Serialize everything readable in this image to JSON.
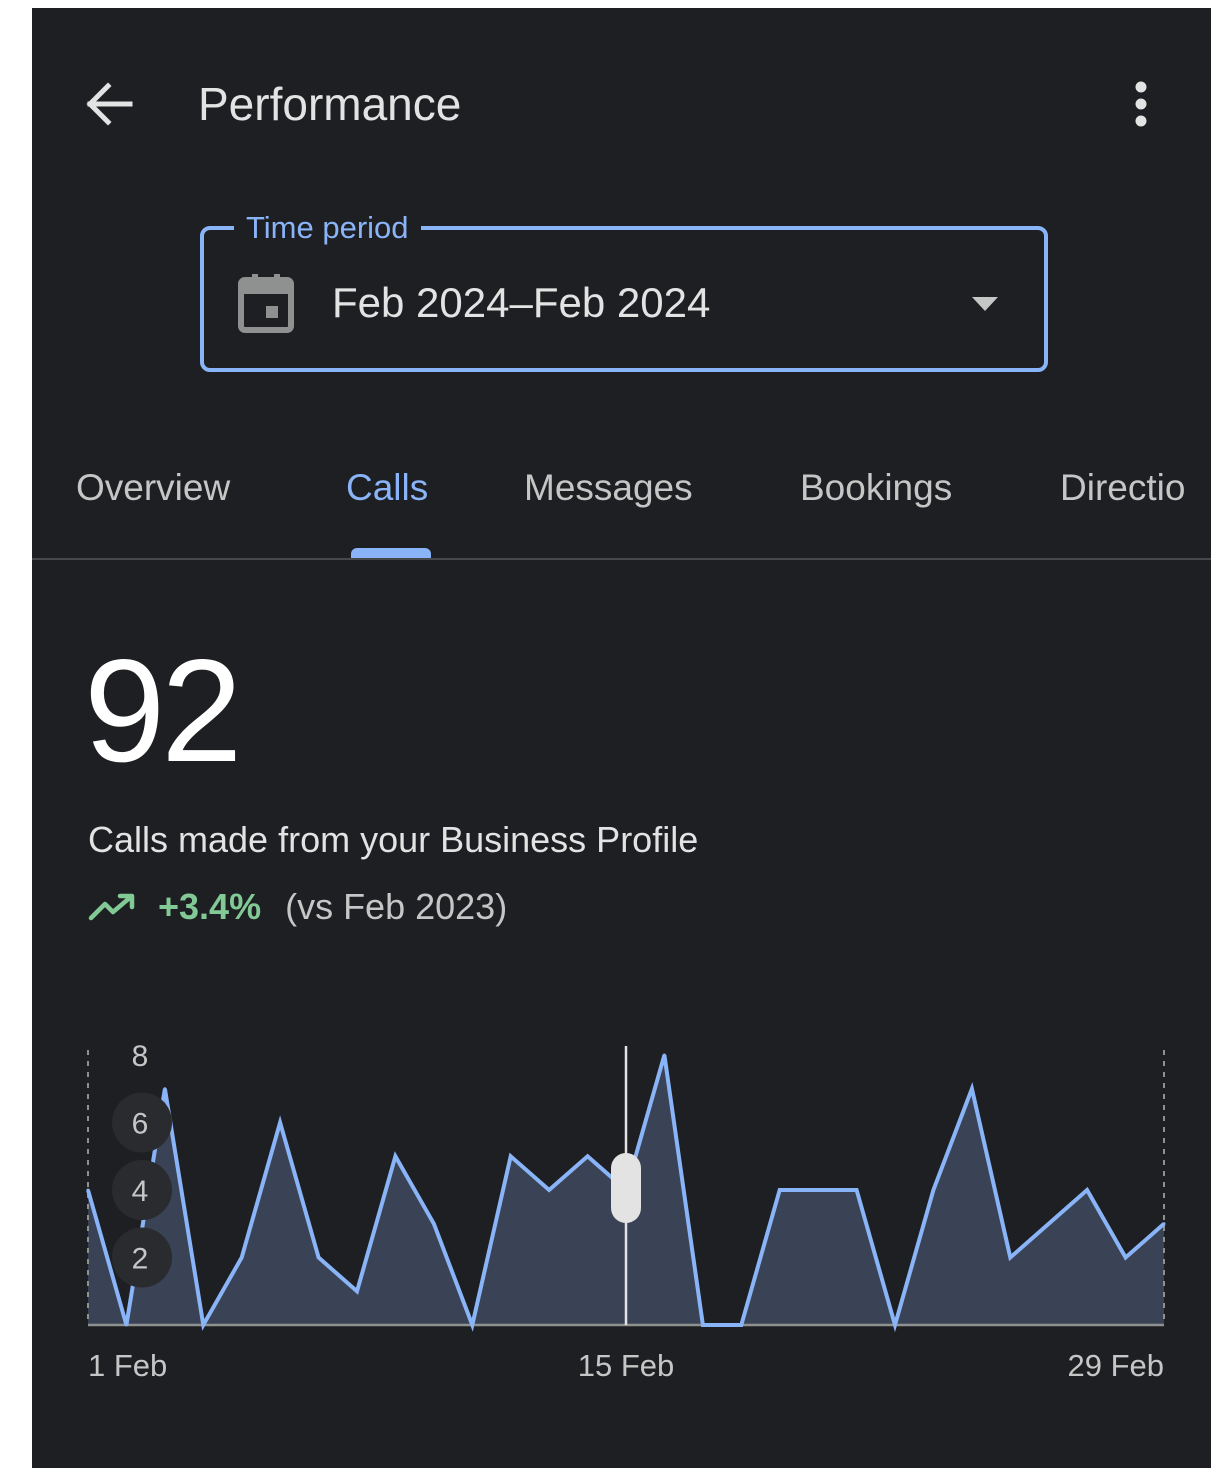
{
  "header": {
    "title": "Performance",
    "back_icon": "arrow-back-icon",
    "more_icon": "more-vert-icon"
  },
  "time_period": {
    "label": "Time period",
    "value": "Feb 2024–Feb 2024",
    "icon": "calendar-icon"
  },
  "tabs": [
    {
      "label": "Overview",
      "active": false
    },
    {
      "label": "Calls",
      "active": true
    },
    {
      "label": "Messages",
      "active": false
    },
    {
      "label": "Bookings",
      "active": false
    },
    {
      "label": "Directio",
      "active": false
    }
  ],
  "metric": {
    "value": "92",
    "description": "Calls made from your Business Profile",
    "trend": "+3.4%",
    "comparison": "(vs Feb 2023)"
  },
  "colors": {
    "background": "#1e1f22",
    "accent": "#8ab4f8",
    "trend_up": "#81c995",
    "area_fill": "#3a4256"
  },
  "chart_data": {
    "type": "area",
    "x": [
      "1 Feb",
      "2 Feb",
      "3 Feb",
      "4 Feb",
      "5 Feb",
      "6 Feb",
      "7 Feb",
      "8 Feb",
      "9 Feb",
      "10 Feb",
      "11 Feb",
      "12 Feb",
      "13 Feb",
      "14 Feb",
      "15 Feb",
      "16 Feb",
      "17 Feb",
      "18 Feb",
      "19 Feb",
      "20 Feb",
      "21 Feb",
      "22 Feb",
      "23 Feb",
      "24 Feb",
      "25 Feb",
      "26 Feb",
      "27 Feb",
      "28 Feb",
      "29 Feb"
    ],
    "values": [
      4,
      0,
      7,
      0,
      2,
      6,
      2,
      1,
      5,
      3,
      0,
      5,
      4,
      5,
      4,
      8,
      0,
      0,
      4,
      4,
      4,
      0,
      4,
      7,
      2,
      3,
      4,
      2,
      3
    ],
    "x_tick_labels": [
      "1 Feb",
      "15 Feb",
      "29 Feb"
    ],
    "y_tick_labels": [
      "8",
      "6",
      "4",
      "2"
    ],
    "ylim": [
      0,
      8
    ],
    "selected_index": 14
  }
}
